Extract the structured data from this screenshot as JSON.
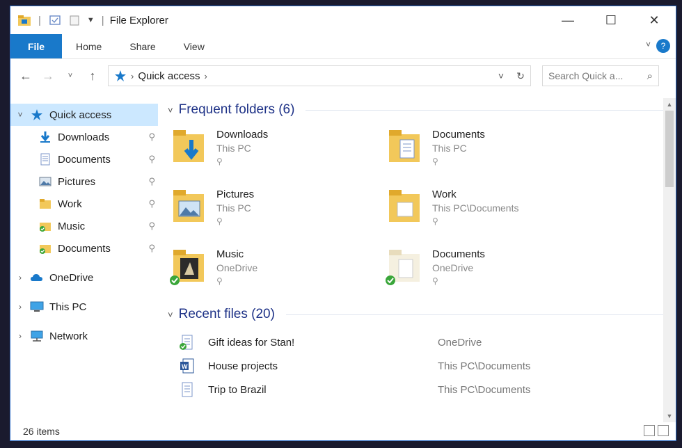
{
  "window": {
    "title": "File Explorer"
  },
  "ribbon": {
    "tabs": [
      "File",
      "Home",
      "Share",
      "View"
    ]
  },
  "address": {
    "crumb": "Quick access"
  },
  "search": {
    "placeholder": "Search Quick a..."
  },
  "nav": {
    "quick_access": "Quick access",
    "children": [
      {
        "label": "Downloads"
      },
      {
        "label": "Documents"
      },
      {
        "label": "Pictures"
      },
      {
        "label": "Work"
      },
      {
        "label": "Music"
      },
      {
        "label": "Documents"
      }
    ],
    "onedrive": "OneDrive",
    "thispc": "This PC",
    "network": "Network"
  },
  "frequent": {
    "header": "Frequent folders (6)",
    "items": [
      {
        "name": "Downloads",
        "loc": "This PC"
      },
      {
        "name": "Documents",
        "loc": "This PC"
      },
      {
        "name": "Pictures",
        "loc": "This PC"
      },
      {
        "name": "Work",
        "loc": "This PC\\Documents"
      },
      {
        "name": "Music",
        "loc": "OneDrive"
      },
      {
        "name": "Documents",
        "loc": "OneDrive"
      }
    ]
  },
  "recent": {
    "header": "Recent files (20)",
    "items": [
      {
        "name": "Gift ideas for Stan!",
        "loc": "OneDrive"
      },
      {
        "name": "House projects",
        "loc": "This PC\\Documents"
      },
      {
        "name": "Trip to Brazil",
        "loc": "This PC\\Documents"
      }
    ]
  },
  "status": {
    "count": "26 items"
  },
  "colors": {
    "accent": "#1979ca",
    "folder": "#f2c85a",
    "selected": "#cce8ff",
    "group_header": "#1e3287"
  }
}
